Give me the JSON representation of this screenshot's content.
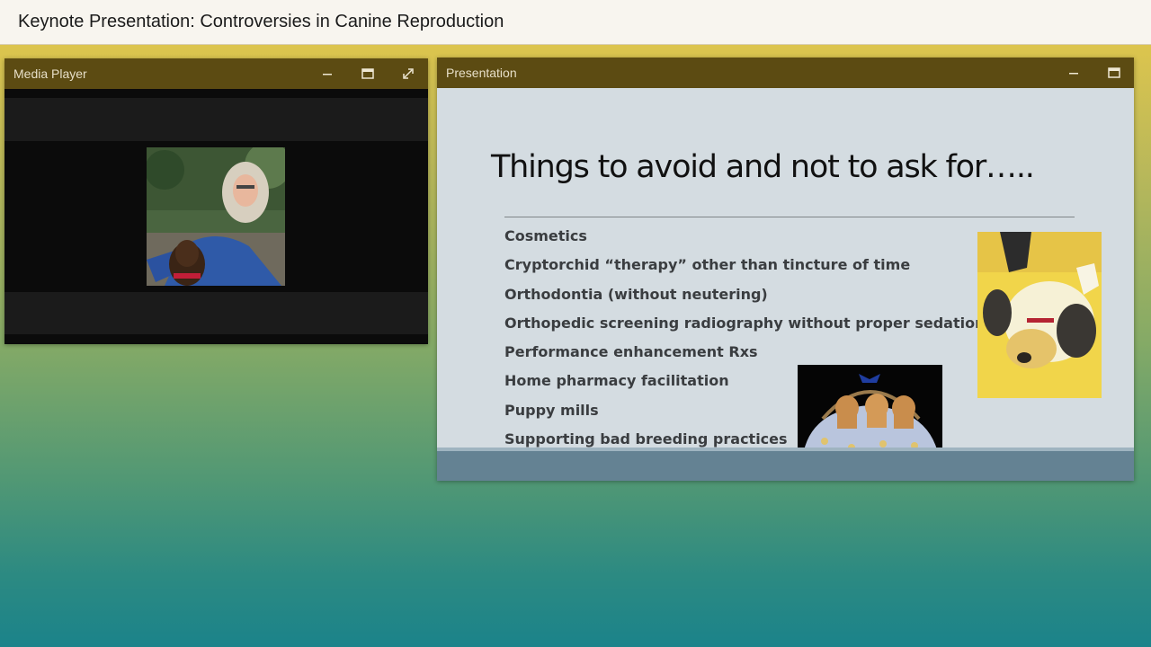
{
  "page": {
    "title": "Keynote Presentation: Controversies in Canine Reproduction"
  },
  "media_player": {
    "title": "Media Player",
    "controls": [
      "minimize-icon",
      "maximize-icon",
      "fullscreen-icon"
    ]
  },
  "presentation": {
    "title": "Presentation",
    "controls": [
      "minimize-icon",
      "maximize-icon"
    ],
    "slide": {
      "heading": "Things to avoid and not to ask for…..",
      "bullets": [
        "Cosmetics",
        "Cryptorchid “therapy” other than tincture of time",
        "Orthodontia (without neutering)",
        "Orthopedic screening radiography without proper sedation",
        "Performance enhancement Rxs",
        "Home pharmacy facilitation",
        "Puppy mills",
        "Supporting bad breeding practices"
      ]
    }
  },
  "colors": {
    "titlebar": "#5c4b12",
    "topbar": "#f8f5ef",
    "slide_bg": "#d4dce1",
    "slide_footer": "#648293"
  }
}
